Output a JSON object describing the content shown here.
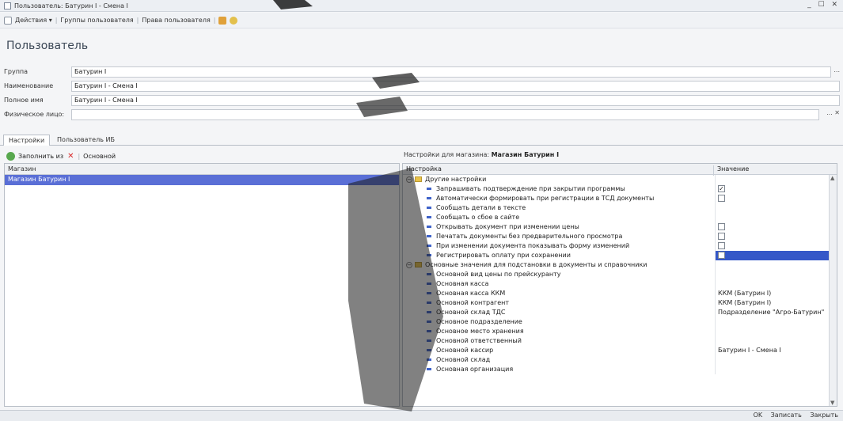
{
  "window": {
    "title": "Пользователь: Батурин I - Смена I",
    "controls": "_ ☐ ✕"
  },
  "menu": {
    "actions": "Действия ▾",
    "groups": "Группы пользователя",
    "rights": "Права пользователя"
  },
  "page": {
    "heading": "Пользователь"
  },
  "fields": [
    {
      "label": "Группа",
      "value": "Батурин I",
      "dots": "..."
    },
    {
      "label": "Наименование",
      "value": "Батурин I - Смена I",
      "dots": ""
    },
    {
      "label": "Полное имя",
      "value": "Батурин I - Смена I",
      "dots": ""
    },
    {
      "label": "Физическое лицо:",
      "value": "",
      "dots": "... ✕"
    }
  ],
  "tabs": [
    "Настройки",
    "Пользователь ИБ"
  ],
  "left": {
    "fill_label": "Заполнить из",
    "main_label": "Основной",
    "column": "Магазин",
    "rows": [
      "Магазин Батурин I"
    ]
  },
  "right": {
    "title_prefix": "Настройки для магазина:",
    "title_store": "Магазин Батурин I",
    "col_setting": "Настройка",
    "col_value": "Значение",
    "rows": [
      {
        "type": "group",
        "name": "Другие настройки",
        "value": "",
        "check": ""
      },
      {
        "type": "item",
        "name": "Запрашивать подтверждение при закрытии программы",
        "value": "",
        "check": "✓"
      },
      {
        "type": "item",
        "name": "Автоматически формировать при регистрации в ТСД документы",
        "value": "",
        "check": " "
      },
      {
        "type": "item",
        "name": "Сообщать детали в тексте",
        "value": "",
        "check": ""
      },
      {
        "type": "item",
        "name": "Сообщать о сбое в сайте",
        "value": "",
        "check": ""
      },
      {
        "type": "item",
        "name": "Открывать документ при изменении цены",
        "value": "",
        "check": " "
      },
      {
        "type": "item",
        "name": "Печатать документы без предварительного просмотра",
        "value": "",
        "check": " "
      },
      {
        "type": "item",
        "name": "При изменении документа показывать форму изменений",
        "value": "",
        "check": " "
      },
      {
        "type": "item",
        "name": "Регистрировать оплату при сохранении",
        "value": "",
        "check": " "
      },
      {
        "type": "group",
        "name": "Основные значения для подстановки в документы и справочники",
        "value": "",
        "check": ""
      },
      {
        "type": "item",
        "name": "Основной вид цены по прейскуранту",
        "value": "",
        "check": ""
      },
      {
        "type": "item",
        "name": "Основная касса",
        "value": "",
        "check": ""
      },
      {
        "type": "item",
        "name": "Основная касса ККМ",
        "value": "ККМ (Батурин I)",
        "check": ""
      },
      {
        "type": "item",
        "name": "Основной контрагент",
        "value": "ККМ (Батурин I)",
        "check": ""
      },
      {
        "type": "item",
        "name": "Основной склад ТДС",
        "value": "Подразделение \"Агро-Батурин\"",
        "check": ""
      },
      {
        "type": "item",
        "name": "Основное подразделение",
        "value": "",
        "check": ""
      },
      {
        "type": "item",
        "name": "Основное место хранения",
        "value": "",
        "check": ""
      },
      {
        "type": "item",
        "name": "Основной ответственный",
        "value": "",
        "check": ""
      },
      {
        "type": "item",
        "name": "Основной кассир",
        "value": "Батурин I - Смена I",
        "check": ""
      },
      {
        "type": "item",
        "name": "Основной склад",
        "value": "",
        "check": ""
      },
      {
        "type": "item",
        "name": "Основная организация",
        "value": "",
        "check": ""
      }
    ]
  },
  "footer": {
    "ok": "OK",
    "save": "Записать",
    "close": "Закрыть"
  },
  "colors": {
    "selection": "#5a6fd6",
    "value_selection": "#3558c8",
    "accent": "#3f63c9"
  }
}
